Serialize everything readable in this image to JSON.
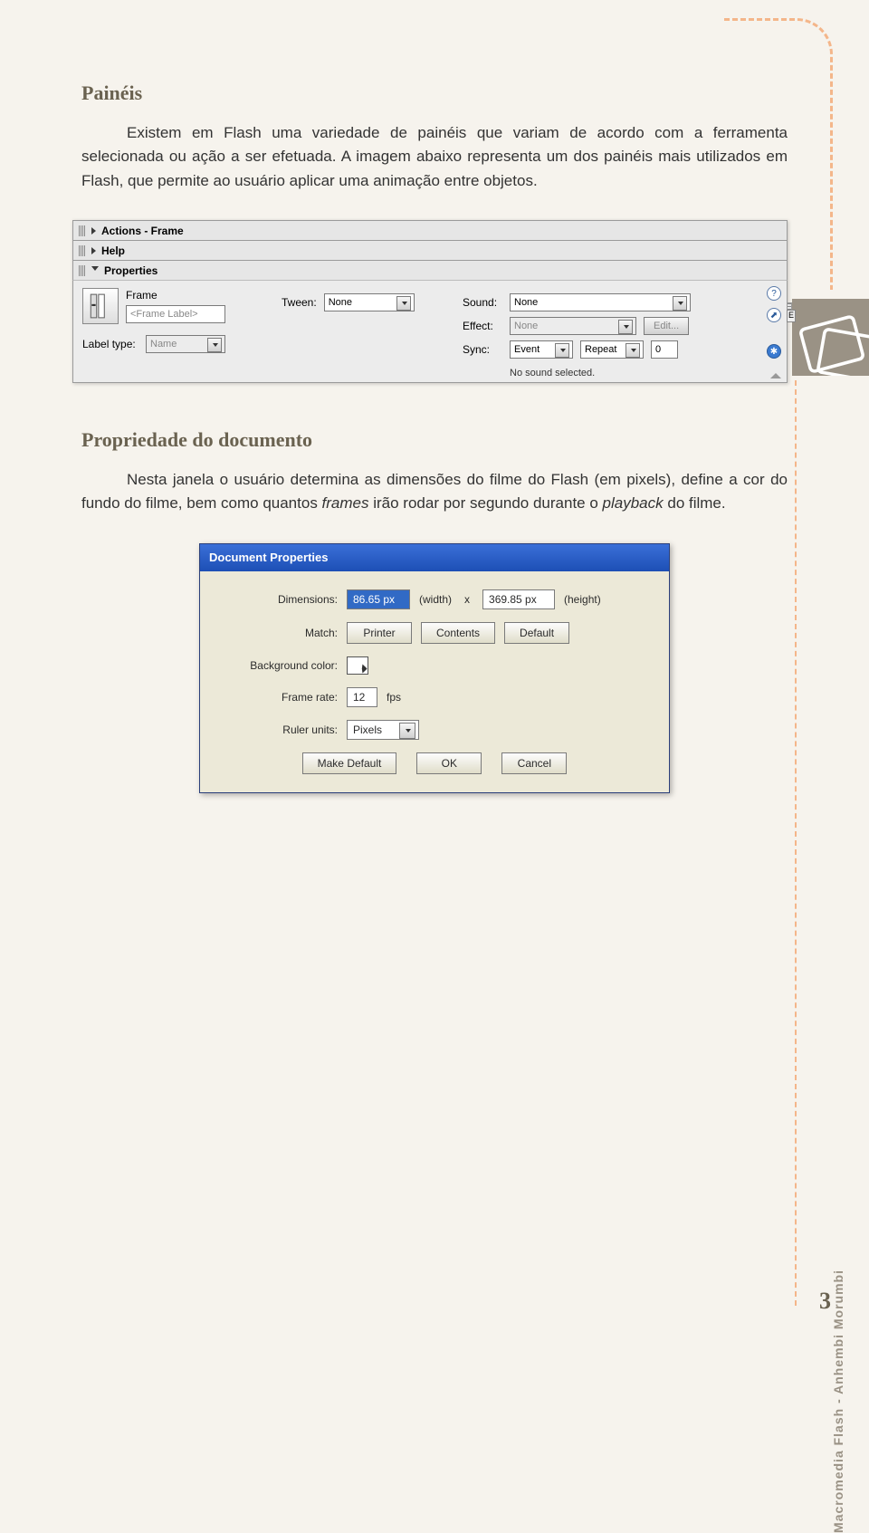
{
  "section1": {
    "heading": "Painéis",
    "para1_a": "Existem em Flash uma variedade de painéis que variam de acordo com a ferramenta selecionada ou ação a ser efetuada. A imagem abaixo representa um dos painéis mais utilizados em Flash, que permite ao usuário aplicar uma animação entre objetos."
  },
  "panels": {
    "actions": "Actions - Frame",
    "help": "Help",
    "properties": "Properties",
    "frame": "Frame",
    "frame_label_ph": "<Frame Label>",
    "label_type": "Label type:",
    "label_type_value": "Name",
    "tween": "Tween:",
    "tween_value": "None",
    "sound": "Sound:",
    "sound_value": "None",
    "effect": "Effect:",
    "effect_value": "None",
    "edit": "Edit...",
    "sync": "Sync:",
    "sync_value1": "Event",
    "sync_value2": "Repeat",
    "sync_value3": "0",
    "no_sound": "No sound selected.",
    "e_badge": "E"
  },
  "section2": {
    "heading": "Propriedade do documento",
    "para_a": "Nesta janela o usuário determina as dimensões do filme do Flash (em pixels), define a cor do fundo do filme, bem como quantos ",
    "para_b": "frames",
    "para_c": " irão rodar por segundo durante o ",
    "para_d": "playback",
    "para_e": " do filme."
  },
  "dialog": {
    "title": "Document Properties",
    "dimensions": "Dimensions:",
    "w_value": "86.65 px",
    "w_label": "(width)",
    "x": "x",
    "h_value": "369.85 px",
    "h_label": "(height)",
    "match": "Match:",
    "printer": "Printer",
    "contents": "Contents",
    "default": "Default",
    "bg": "Background color:",
    "framerate": "Frame rate:",
    "framerate_value": "12",
    "fps": "fps",
    "ruler": "Ruler units:",
    "ruler_value": "Pixels",
    "make_default": "Make Default",
    "ok": "OK",
    "cancel": "Cancel"
  },
  "footer": {
    "text": "Macromedia Flash - Anhembi Morumbi",
    "page": "3"
  }
}
